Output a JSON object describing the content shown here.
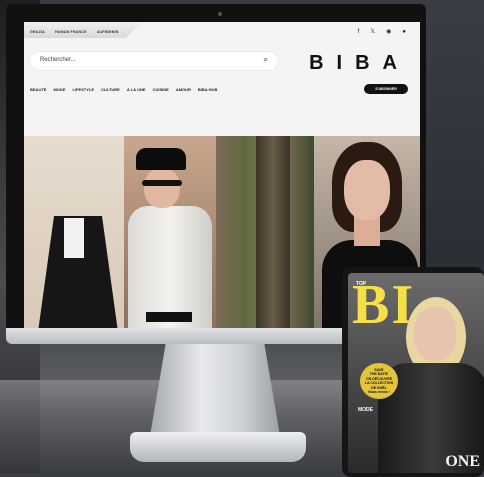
{
  "website": {
    "top_links": [
      "GRAZIA",
      "HUMAN FRANCE",
      "AUFEMININ"
    ],
    "social_icons": [
      "facebook-icon",
      "x-icon",
      "instagram-icon",
      "pinterest-icon"
    ],
    "search": {
      "placeholder": "Rechercher..."
    },
    "logo": "BIBA",
    "main_nav": [
      "BEAUTÉ",
      "MODE",
      "LIFESTYLE",
      "CULTURE",
      "À LA UNE",
      "CUISINE",
      "AMOUR",
      "BIBA HUB"
    ],
    "subscribe_label": "S'ABONNER"
  },
  "magazine_cover": {
    "title": "BI",
    "top_label": "TOP",
    "badge": [
      "SAVE",
      "THE DATE!",
      "ON DÉCOUVRE",
      "LA COLLECTION",
      "DE NOËL",
      "Nous venez !"
    ],
    "cover_lines": [
      "MODE"
    ],
    "bottom_text": "ONE"
  },
  "colors": {
    "screen_bg": "#f4f4f5",
    "button_bg": "#111111",
    "cover_accent": "#f5e04a"
  }
}
